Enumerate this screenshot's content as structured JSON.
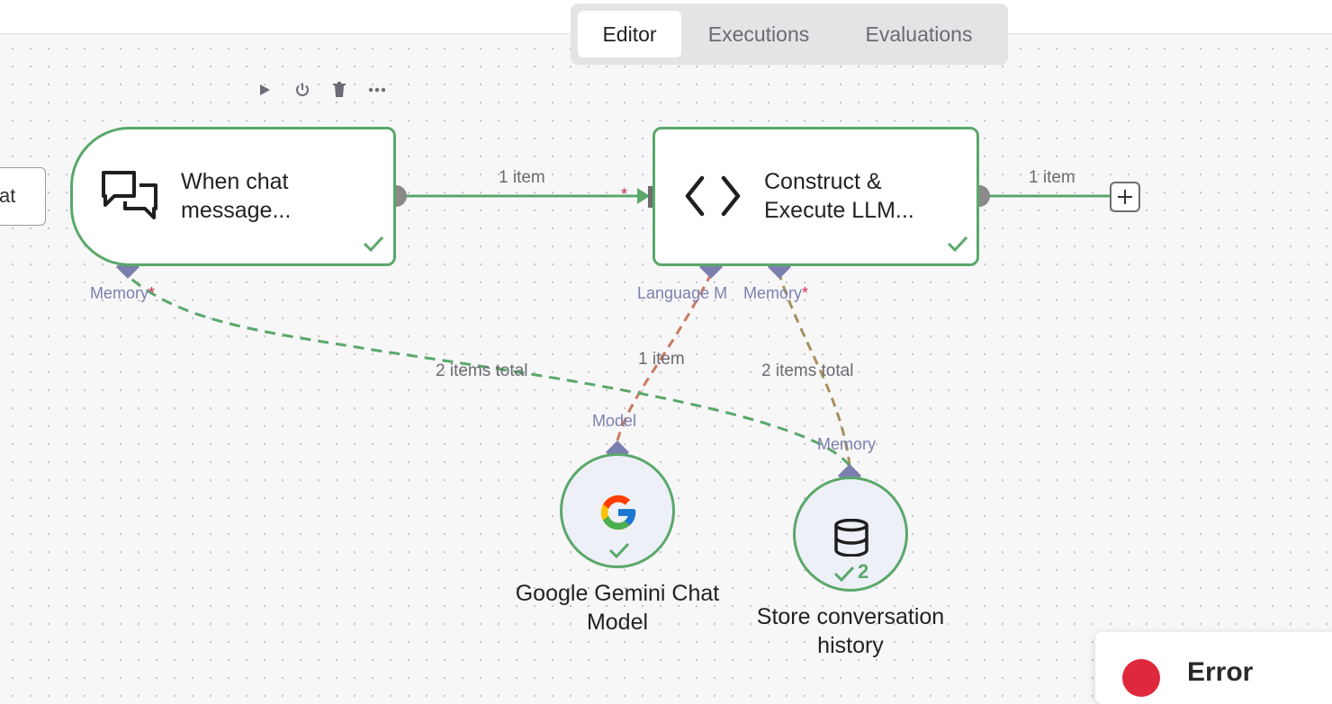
{
  "tabs": [
    {
      "label": "Editor",
      "active": true
    },
    {
      "label": "Executions",
      "active": false
    },
    {
      "label": "Evaluations",
      "active": false
    }
  ],
  "left_stub": {
    "label": "at"
  },
  "nodes": {
    "chat_trigger": {
      "title": "When chat\nmessage...",
      "icon": "chat-bubbles-icon",
      "status": "success"
    },
    "llm_chain": {
      "title": "Construct &\nExecute LLM...",
      "icon": "code-brackets-icon",
      "status": "success"
    },
    "gemini": {
      "caption": "Google Gemini Chat\nModel",
      "icon": "google-icon",
      "status": "success"
    },
    "memory_store": {
      "caption": "Store conversation\nhistory",
      "icon": "database-icon",
      "status": "success",
      "run_count": "2"
    }
  },
  "ports": {
    "trigger_memory": "Memory",
    "llm_language_model": "Language M",
    "llm_memory": "Memory",
    "gemini_model": "Model",
    "store_memory": "Memory",
    "required_mark": "*"
  },
  "edges": {
    "trigger_to_llm": "1 item",
    "llm_output": "1 item",
    "gemini_to_llm": "1 item",
    "store_to_llm": "2 items total",
    "store_to_trigger": "2 items total"
  },
  "toast": {
    "title": "Error"
  },
  "colors": {
    "success_green": "#5aa86a",
    "port_purple": "#7b7fae",
    "model_edge": "#c97a5e",
    "memory_edge": "#a8905c",
    "error_red": "#e0283c"
  }
}
